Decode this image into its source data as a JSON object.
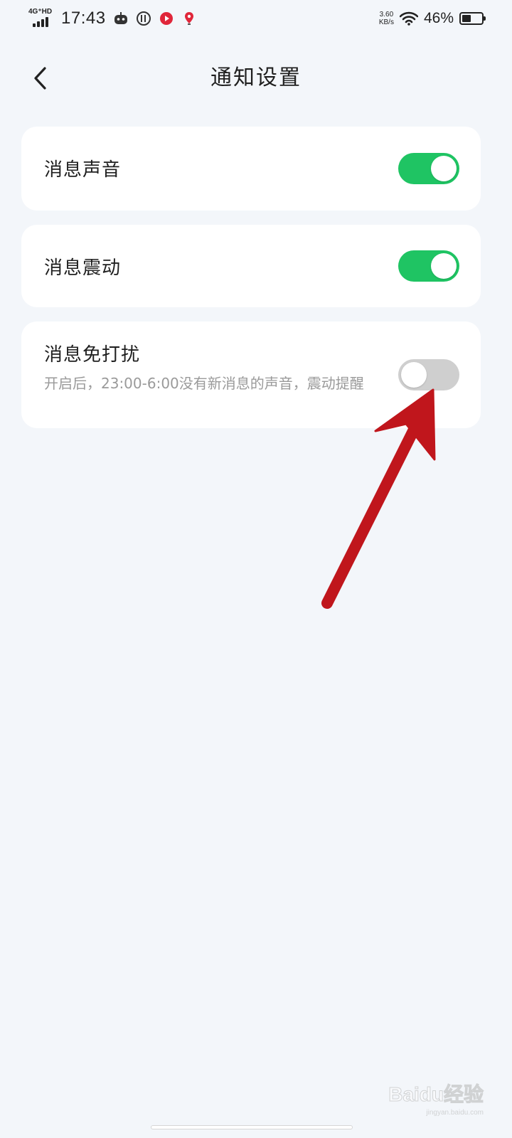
{
  "status_bar": {
    "network": "4G⁺HD",
    "time": "17:43",
    "speed_value": "3.60",
    "speed_unit": "KB/s",
    "battery_percent_text": "46%",
    "battery_level": 0.46,
    "icons": [
      "robot-app-icon",
      "circle-app-icon",
      "red-video-app-icon",
      "location-pin-icon",
      "wifi-icon",
      "battery-icon"
    ]
  },
  "header": {
    "title": "通知设置",
    "back_icon": "chevron-left-icon"
  },
  "settings": [
    {
      "title": "消息声音",
      "description": "",
      "enabled": true
    },
    {
      "title": "消息震动",
      "description": "",
      "enabled": true
    },
    {
      "title": "消息免打扰",
      "description": "开启后，23:00-6:00没有新消息的声音，震动提醒",
      "enabled": false
    }
  ],
  "colors": {
    "background": "#f3f6fa",
    "card": "#ffffff",
    "toggle_on": "#1fc463",
    "toggle_off": "#cfcfcf",
    "annotation_arrow": "#c0161c"
  },
  "watermark": {
    "logo": "Baidu经验",
    "subtitle": "jingyan.baidu.com"
  }
}
